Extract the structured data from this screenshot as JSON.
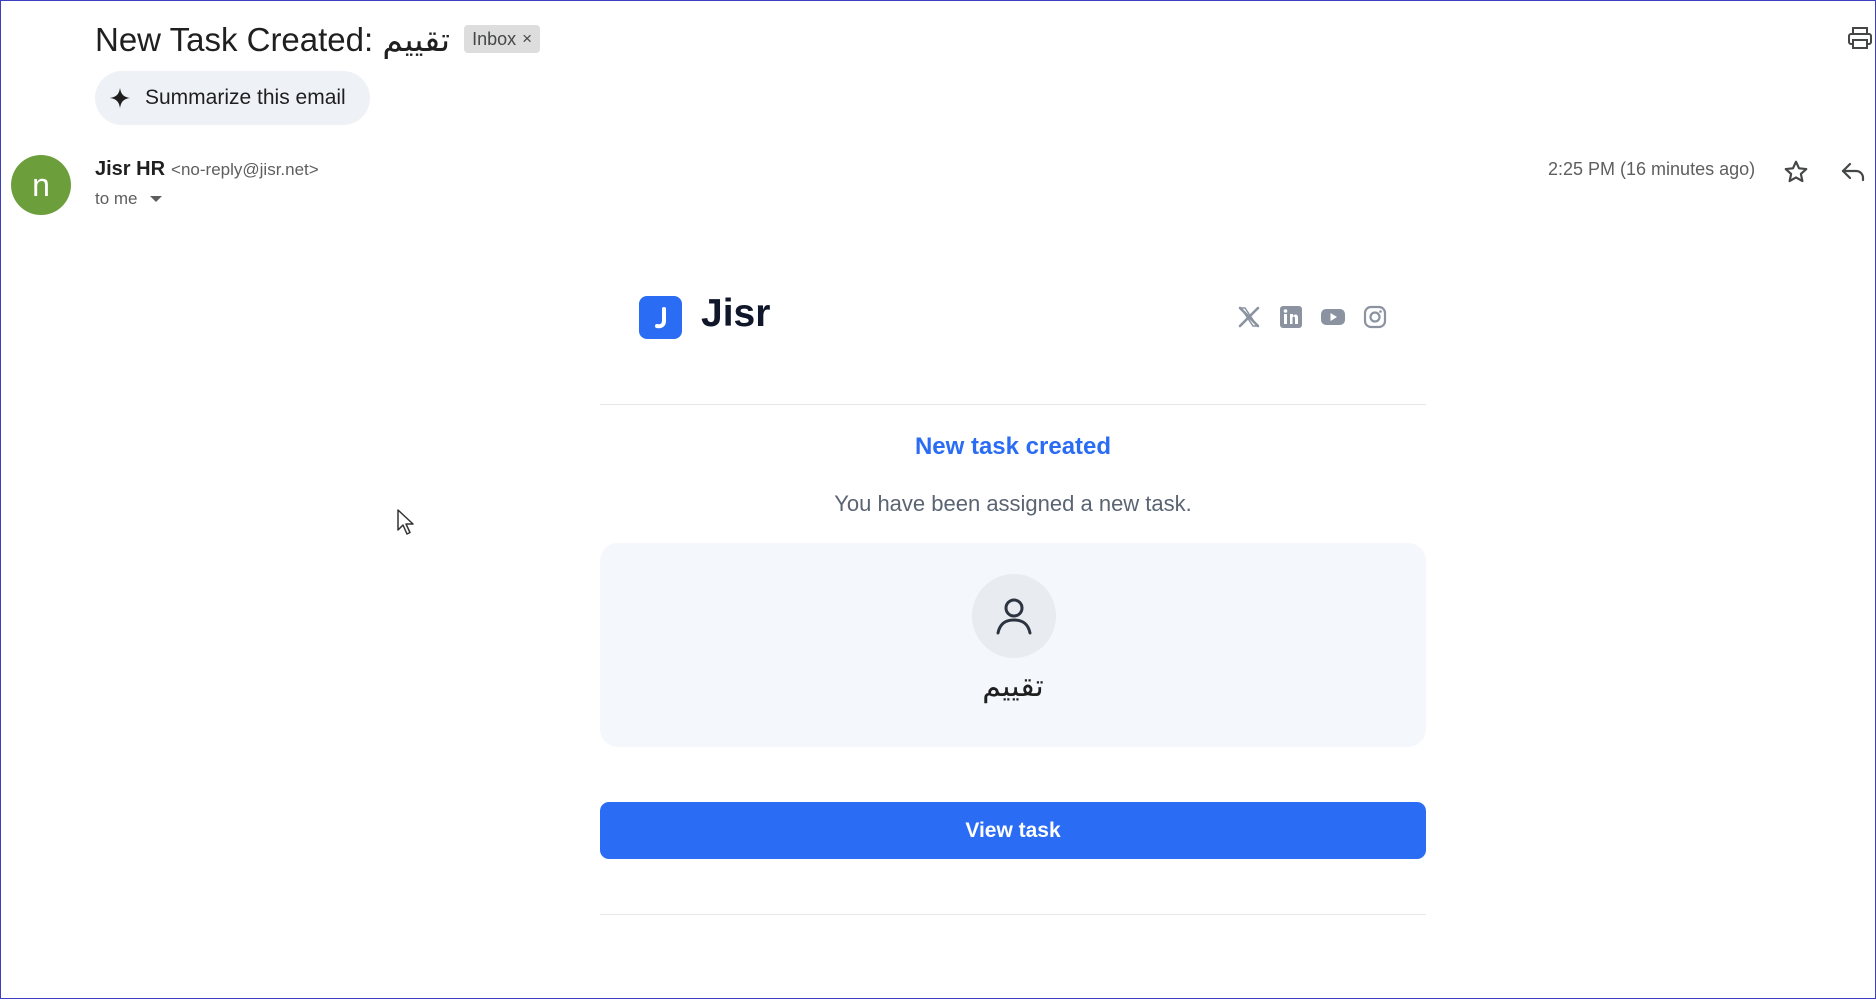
{
  "subject": "New Task Created: تقييم",
  "label_chip": {
    "text": "Inbox",
    "remove": "×"
  },
  "summarize_label": "Summarize this email",
  "sender": {
    "avatar_initial": "n",
    "name": "Jisr HR",
    "email": "<no-reply@jisr.net>",
    "to": "to me",
    "timestamp": "2:25 PM (16 minutes ago)"
  },
  "email_body": {
    "brand_name": "Jisr",
    "socials": [
      "x-icon",
      "linkedin-icon",
      "youtube-icon",
      "instagram-icon"
    ],
    "headline": "New task created",
    "subline": "You have been assigned a new task.",
    "task_title": "تقييم",
    "button_label": "View task"
  },
  "colors": {
    "accent": "#2b6cf5",
    "avatar": "#6d9e3c",
    "card_bg": "#f4f7fc"
  },
  "icons": [
    "print-icon",
    "sparkle-icon",
    "star-icon",
    "reply-icon",
    "person-icon"
  ]
}
